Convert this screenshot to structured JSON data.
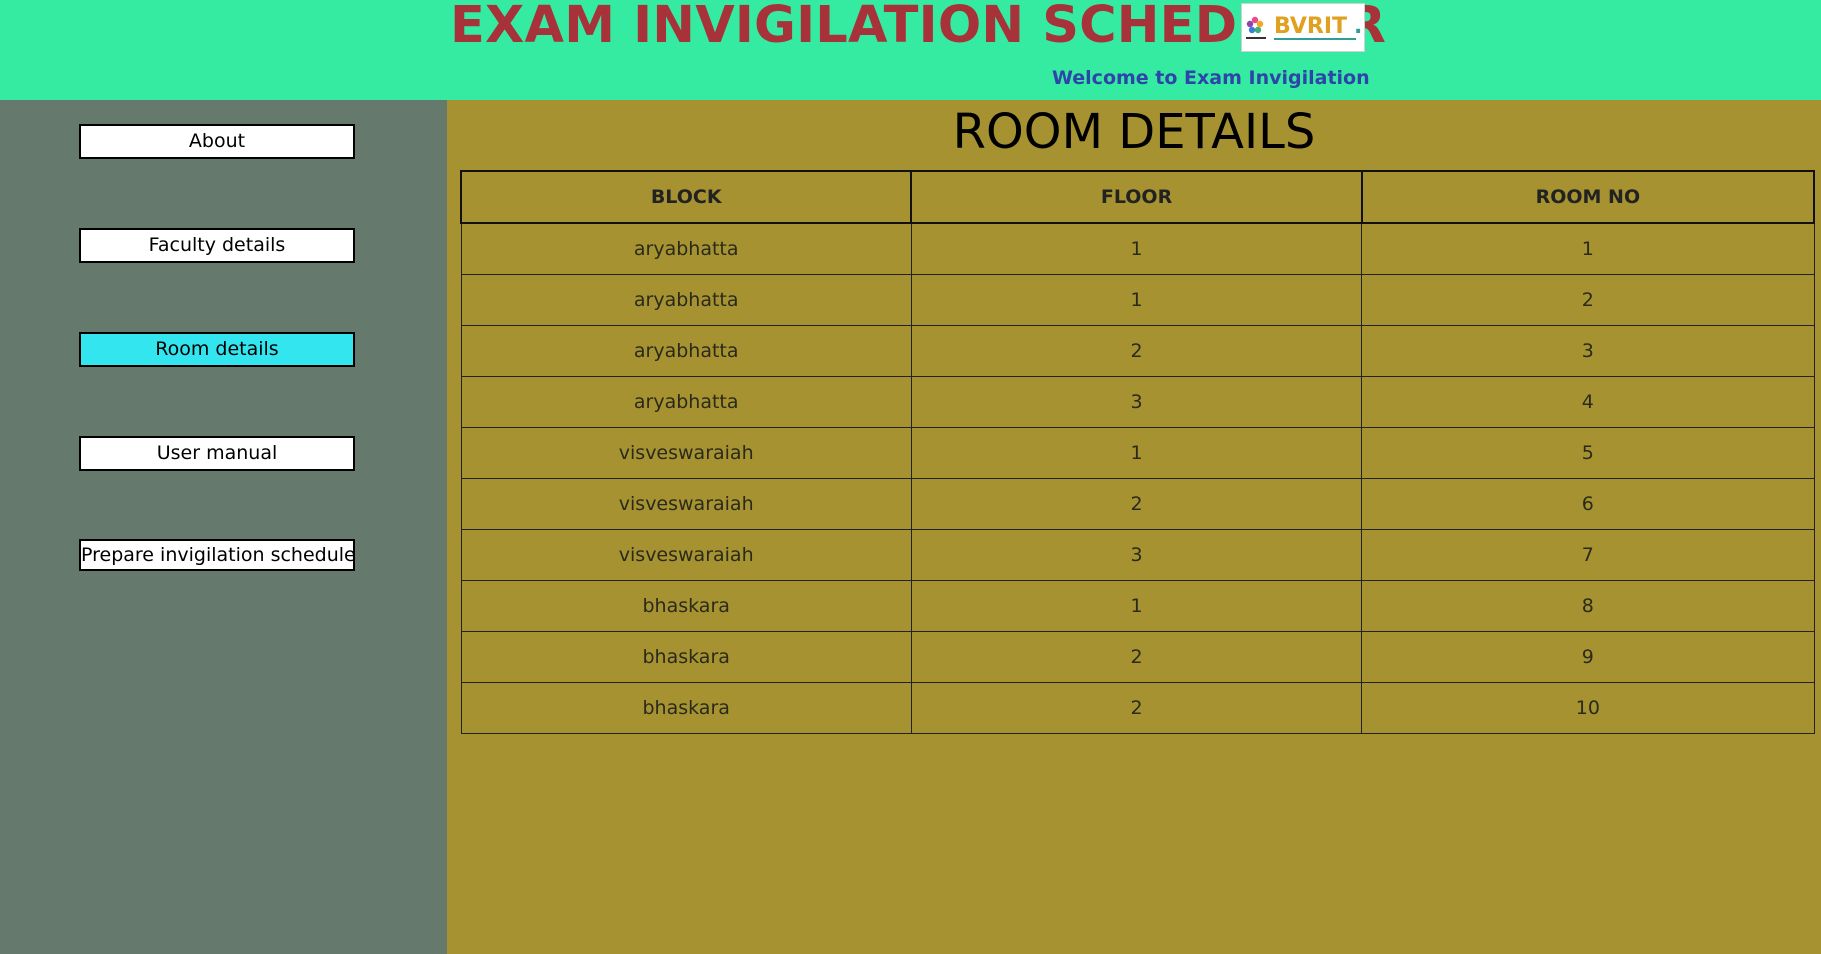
{
  "header": {
    "title": "EXAM INVIGILATION SCHEDULER",
    "logo_text": "BVRIT",
    "welcome": "Welcome to Exam Invigilation"
  },
  "sidebar": {
    "items": [
      {
        "label": "About",
        "active": false
      },
      {
        "label": "Faculty details",
        "active": false
      },
      {
        "label": "Room details",
        "active": true
      },
      {
        "label": "User manual",
        "active": false
      },
      {
        "label": "Prepare invigilation schedule",
        "active": false
      }
    ]
  },
  "main": {
    "title": "ROOM DETAILS",
    "table": {
      "columns": [
        "BLOCK",
        "FLOOR",
        "ROOM NO"
      ],
      "rows": [
        [
          "aryabhatta",
          "1",
          "1"
        ],
        [
          "aryabhatta",
          "1",
          "2"
        ],
        [
          "aryabhatta",
          "2",
          "3"
        ],
        [
          "aryabhatta",
          "3",
          "4"
        ],
        [
          "visveswaraiah",
          "1",
          "5"
        ],
        [
          "visveswaraiah",
          "2",
          "6"
        ],
        [
          "visveswaraiah",
          "3",
          "7"
        ],
        [
          "bhaskara",
          "1",
          "8"
        ],
        [
          "bhaskara",
          "2",
          "9"
        ],
        [
          "bhaskara",
          "2",
          "10"
        ]
      ]
    }
  },
  "colors": {
    "header_bg": "#35eba2",
    "title_color": "#a8323a",
    "welcome_color": "#2f44a8",
    "sidebar_bg": "#66796d",
    "main_bg": "#a69231",
    "active_button": "#33e5ef"
  }
}
